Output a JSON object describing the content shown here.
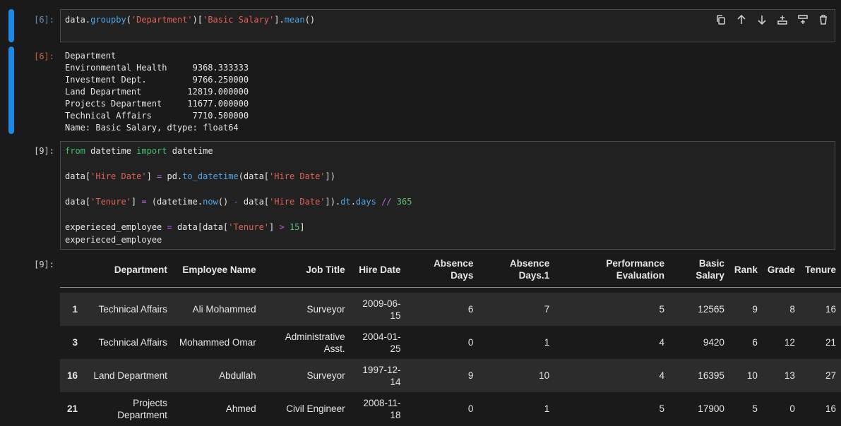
{
  "cell6": {
    "in_prompt": "[6]:",
    "out_prompt": "[6]:",
    "code_parts": [
      {
        "t": "data",
        "c": "tok-name"
      },
      {
        "t": ".",
        "c": "tok-name"
      },
      {
        "t": "groupby",
        "c": "tok-attr"
      },
      {
        "t": "(",
        "c": "tok-name"
      },
      {
        "t": "'Department'",
        "c": "tok-str"
      },
      {
        "t": ")[",
        "c": "tok-name"
      },
      {
        "t": "'Basic Salary'",
        "c": "tok-str"
      },
      {
        "t": "].",
        "c": "tok-name"
      },
      {
        "t": "mean",
        "c": "tok-attr"
      },
      {
        "t": "()",
        "c": "tok-name"
      }
    ],
    "output_lines": [
      "Department",
      "Environmental Health     9368.333333",
      "Investment Dept.         9766.250000",
      "Land Department         12819.000000",
      "Projects Department     11677.000000",
      "Technical Affairs        7710.500000",
      "Name: Basic Salary, dtype: float64"
    ]
  },
  "toolbar": {
    "icons": [
      "copy-icon",
      "arrow-up-icon",
      "arrow-down-icon",
      "insert-above-icon",
      "insert-below-icon",
      "trash-icon"
    ]
  },
  "cell9": {
    "in_prompt": "[9]:",
    "out_prompt": "[9]:",
    "lines": [
      [
        {
          "t": "from",
          "c": "tok-kw"
        },
        {
          "t": " datetime ",
          "c": "tok-name"
        },
        {
          "t": "import",
          "c": "tok-kw"
        },
        {
          "t": " datetime",
          "c": "tok-name"
        }
      ],
      [],
      [
        {
          "t": "data[",
          "c": "tok-name"
        },
        {
          "t": "'Hire Date'",
          "c": "tok-str"
        },
        {
          "t": "] ",
          "c": "tok-name"
        },
        {
          "t": "=",
          "c": "tok-op"
        },
        {
          "t": " pd.",
          "c": "tok-name"
        },
        {
          "t": "to_datetime",
          "c": "tok-attr"
        },
        {
          "t": "(data[",
          "c": "tok-name"
        },
        {
          "t": "'Hire Date'",
          "c": "tok-str"
        },
        {
          "t": "])",
          "c": "tok-name"
        }
      ],
      [],
      [
        {
          "t": "data[",
          "c": "tok-name"
        },
        {
          "t": "'Tenure'",
          "c": "tok-str"
        },
        {
          "t": "] ",
          "c": "tok-name"
        },
        {
          "t": "=",
          "c": "tok-op"
        },
        {
          "t": " (datetime.",
          "c": "tok-name"
        },
        {
          "t": "now",
          "c": "tok-attr"
        },
        {
          "t": "() ",
          "c": "tok-name"
        },
        {
          "t": "-",
          "c": "tok-op"
        },
        {
          "t": " data[",
          "c": "tok-name"
        },
        {
          "t": "'Hire Date'",
          "c": "tok-str"
        },
        {
          "t": "]).",
          "c": "tok-name"
        },
        {
          "t": "dt",
          "c": "tok-attr"
        },
        {
          "t": ".",
          "c": "tok-name"
        },
        {
          "t": "days",
          "c": "tok-attr"
        },
        {
          "t": " ",
          "c": "tok-name"
        },
        {
          "t": "//",
          "c": "tok-op"
        },
        {
          "t": " ",
          "c": "tok-name"
        },
        {
          "t": "365",
          "c": "tok-num"
        }
      ],
      [],
      [
        {
          "t": "experieced_employee ",
          "c": "tok-name"
        },
        {
          "t": "=",
          "c": "tok-op"
        },
        {
          "t": " data[data[",
          "c": "tok-name"
        },
        {
          "t": "'Tenure'",
          "c": "tok-str"
        },
        {
          "t": "] ",
          "c": "tok-name"
        },
        {
          "t": ">",
          "c": "tok-op"
        },
        {
          "t": " ",
          "c": "tok-name"
        },
        {
          "t": "15",
          "c": "tok-num"
        },
        {
          "t": "]",
          "c": "tok-name"
        }
      ],
      [
        {
          "t": "experieced_employee",
          "c": "tok-name"
        }
      ]
    ]
  },
  "table": {
    "columns": [
      "",
      "Department",
      "Employee Name",
      "Job Title",
      "Hire Date",
      "Absence Days",
      "Absence Days.1",
      "Performance Evaluation",
      "Basic Salary",
      "Rank",
      "Grade",
      "Tenure"
    ],
    "rows": [
      [
        "1",
        "Technical Affairs",
        "Ali Mohammed",
        "Surveyor",
        "2009-06-15",
        "6",
        "7",
        "5",
        "12565",
        "9",
        "8",
        "16"
      ],
      [
        "3",
        "Technical Affairs",
        "Mohammed Omar",
        "Administrative Asst.",
        "2004-01-25",
        "0",
        "1",
        "4",
        "9420",
        "6",
        "12",
        "21"
      ],
      [
        "16",
        "Land Department",
        "Abdullah",
        "Surveyor",
        "1997-12-14",
        "9",
        "10",
        "4",
        "16395",
        "10",
        "13",
        "27"
      ],
      [
        "21",
        "Projects Department",
        "Ahmed",
        "Civil Engineer",
        "2008-11-18",
        "0",
        "1",
        "5",
        "17900",
        "5",
        "0",
        "16"
      ]
    ]
  }
}
